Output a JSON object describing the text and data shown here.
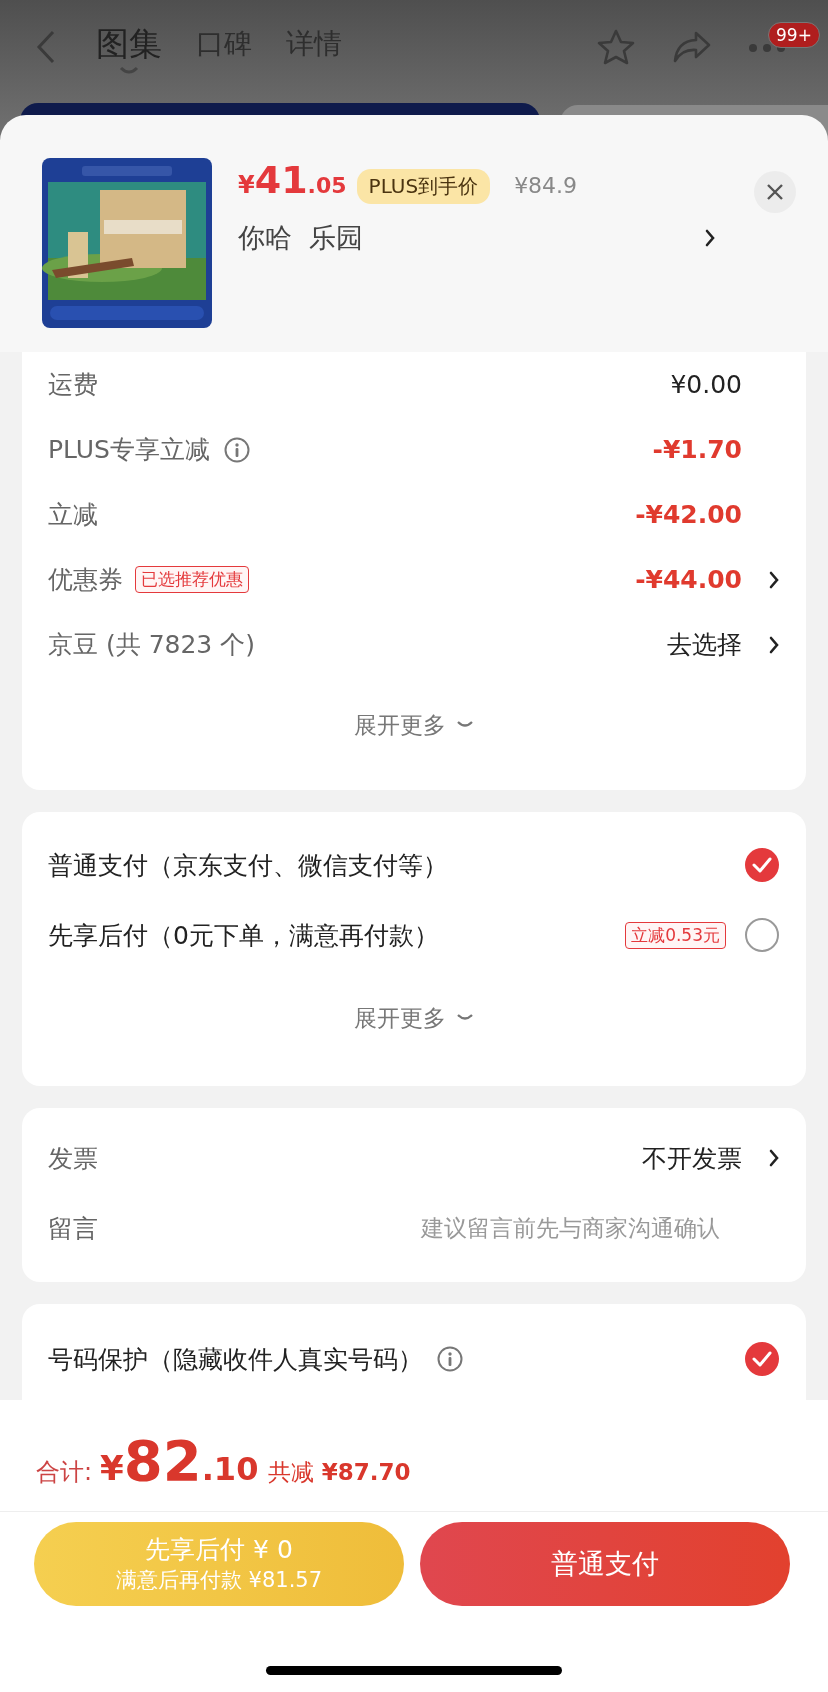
{
  "nav": {
    "tabs": [
      {
        "label": "图集",
        "selected": true
      },
      {
        "label": "口碑",
        "selected": false
      },
      {
        "label": "详情",
        "selected": false
      }
    ],
    "badge": "99+"
  },
  "product": {
    "price_symbol": "¥",
    "price_int": "41",
    "price_dec": ".05",
    "plus_tag": "PLUS到手价",
    "original_price": "¥84.9",
    "spec": "你哈  乐园"
  },
  "fees": {
    "rows": [
      {
        "label": "运费",
        "info": false,
        "value": "¥0.00",
        "discount": false,
        "arrow": false
      },
      {
        "label": "PLUS专享立减",
        "info": true,
        "value": "-¥1.70",
        "discount": true,
        "arrow": false
      },
      {
        "label": "立减",
        "info": false,
        "value": "-¥42.00",
        "discount": true,
        "arrow": false
      },
      {
        "label": "优惠券",
        "info": false,
        "tag": "已选推荐优惠",
        "value": "-¥44.00",
        "discount": true,
        "arrow": true
      },
      {
        "label": "京豆 (共 7823 个)",
        "info": false,
        "value": "去选择",
        "discount": false,
        "arrow": true
      }
    ],
    "more": "展开更多"
  },
  "payment": {
    "options": [
      {
        "label": "普通支付（京东支付、微信支付等）",
        "selected": true
      },
      {
        "label": "先享后付（0元下单，满意再付款）",
        "tag": "立减0.53元",
        "selected": false
      }
    ],
    "more": "展开更多"
  },
  "extras": {
    "rows": [
      {
        "kind": "value",
        "label": "发票",
        "value": "不开发票"
      },
      {
        "kind": "input",
        "label": "留言",
        "placeholder": "建议留言前先与商家沟通确认"
      }
    ]
  },
  "privacy": {
    "label": "号码保护（隐藏收件人真实号码）",
    "checked": true
  },
  "footer": {
    "total_label": "合计:",
    "total_symbol": "¥",
    "total_int": "82",
    "total_dec": ".10",
    "saved_label": "共减",
    "saved_value": "¥87.70",
    "buttons": [
      {
        "kind": "later",
        "title": "先享后付 ¥ 0",
        "subtitle": "满意后再付款 ¥81.57"
      },
      {
        "kind": "pay",
        "title": "普通支付"
      }
    ]
  }
}
